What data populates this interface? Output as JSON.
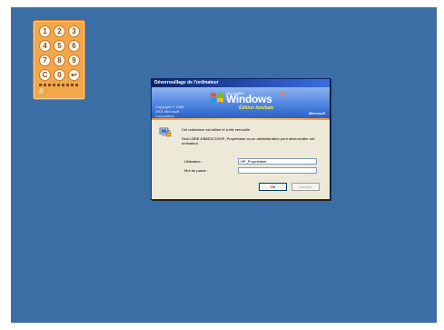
{
  "keypad": {
    "keys": [
      "1",
      "2",
      "3",
      "4",
      "5",
      "6",
      "7",
      "8",
      "9",
      "C",
      "0",
      "↩"
    ],
    "logo": "Ω"
  },
  "dialog": {
    "title": "Déverrouillage de l'ordinateur",
    "banner": {
      "copyright": "Copyright © 1985-2001 Microsoft Corporation",
      "ms_small": "Microsoft®",
      "wordmark": "Windows",
      "xp": "xp",
      "edition": "Édition familiale",
      "brand": "Microsoft"
    },
    "message_locked": "Cet ordinateur est utilisé et a été verrouillé.",
    "message_detail": "Seul LBRE-EB6E3C33\\HP_Propriétaire ou un administrateur peut déverrouiller cet ordinateur.",
    "user_label": "Utilisateur :",
    "user_value": "HP_Propriétaire",
    "password_label": "Mot de passe :",
    "password_value": "",
    "ok_label": "OK",
    "cancel_label": "Annuler"
  },
  "colors": {
    "desktop": "#3b6ea5",
    "keypad": "#f2a74a",
    "dialog_bg": "#ece9d8",
    "titlebar": "#0a246a"
  }
}
